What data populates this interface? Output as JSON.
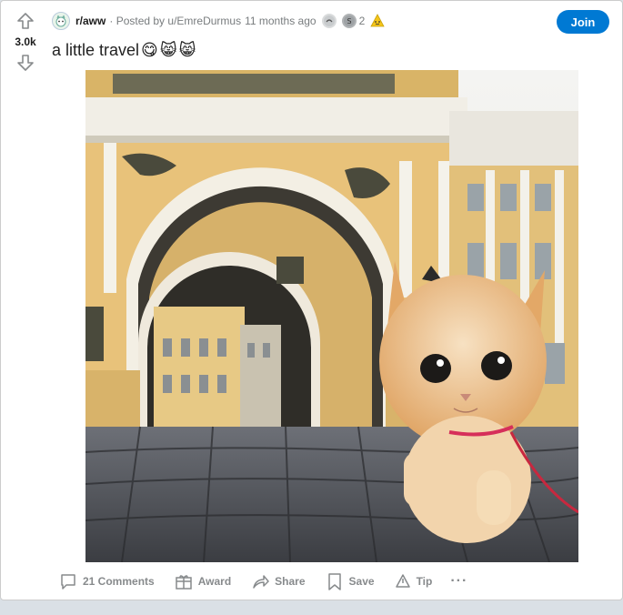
{
  "vote": {
    "score": "3.0k"
  },
  "header": {
    "subreddit": "r/aww",
    "posted_by": "· Posted by u/EmreDurmus",
    "time_ago": "11 months ago",
    "award_count": "2",
    "join_label": "Join"
  },
  "post": {
    "title": "a little travel",
    "title_emojis": [
      "😋",
      "😸",
      "😸"
    ]
  },
  "actions": {
    "comments": "21 Comments",
    "award": "Award",
    "share": "Share",
    "save": "Save",
    "tip": "Tip",
    "more": "···"
  },
  "colors": {
    "join": "#0079d3",
    "meta": "#787c7e",
    "action": "#878a8c"
  }
}
